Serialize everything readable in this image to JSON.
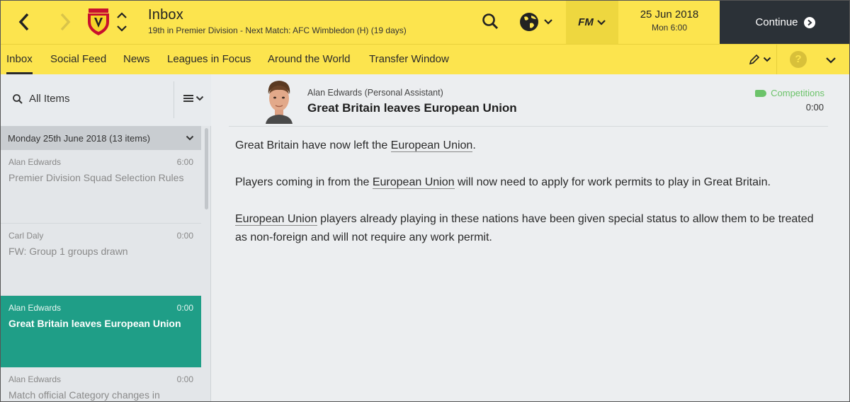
{
  "header": {
    "title": "Inbox",
    "subtitle": "19th in Premier Division - Next Match: AFC Wimbledon (H) (19 days)",
    "back_icon": "chevron-left-icon",
    "forward_icon": "chevron-right-icon",
    "date": "25 Jun 2018",
    "day_time": "Mon 6:00",
    "fm_label": "FM",
    "continue_label": "Continue",
    "colors": {
      "bar": "#fce44e",
      "continue_bg": "#2b3137"
    }
  },
  "tabs": [
    {
      "label": "Inbox",
      "active": true
    },
    {
      "label": "Social Feed",
      "active": false
    },
    {
      "label": "News",
      "active": false
    },
    {
      "label": "Leagues in Focus",
      "active": false
    },
    {
      "label": "Around the World",
      "active": false
    },
    {
      "label": "Transfer Window",
      "active": false
    }
  ],
  "sidebar": {
    "filter_label": "All Items",
    "group_label": "Monday 25th June 2018 (13 items)",
    "messages": [
      {
        "sender": "Alan Edwards",
        "time": "6:00",
        "subject": "Premier Division Squad Selection Rules",
        "selected": false
      },
      {
        "sender": "Carl Daly",
        "time": "0:00",
        "subject": "FW: Group 1 groups drawn",
        "selected": false
      },
      {
        "sender": "Alan Edwards",
        "time": "0:00",
        "subject": "Great Britain leaves European Union",
        "selected": true
      },
      {
        "sender": "Alan Edwards",
        "time": "0:00",
        "subject": "Match official Category changes in",
        "selected": false
      }
    ],
    "colors": {
      "selected": "#1f9e87"
    }
  },
  "message": {
    "sender": "Alan Edwards",
    "role": "(Personal Assistant)",
    "subject": "Great Britain leaves European Union",
    "tag": "Competitions",
    "time": "0:00",
    "p1": {
      "a": "Great Britain have now left the ",
      "link": "European Union",
      "b": "."
    },
    "p2": {
      "a": "Players coming in from the ",
      "link": "European Union",
      "b": " will now need to apply for work permits to play in Great Britain."
    },
    "p3": {
      "link": "European Union",
      "b": " players already playing in these nations have been given special status to allow them to be treated as non-foreign and will not require any work permit."
    }
  }
}
